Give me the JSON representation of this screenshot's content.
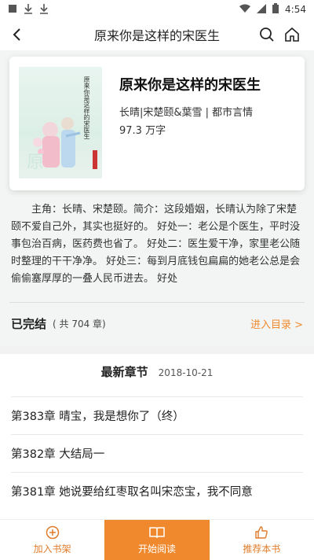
{
  "status_bar": {
    "time": "4:54",
    "icons": [
      "notification-square-icon",
      "download-icon",
      "download-icon",
      "wifi-icon",
      "signal-icon",
      "battery-icon"
    ]
  },
  "nav": {
    "title": "原来你是这样的宋医生",
    "icons": [
      "back-arrow-icon",
      "search-icon",
      "home-icon"
    ]
  },
  "book": {
    "title": "原来你是这样的宋医生",
    "meta": "长晴|宋楚颐&葉雪  |  都市言情",
    "words": "97.3 万字",
    "cover_text": "原来你是这样的宋医生"
  },
  "intro": "主角：长晴、宋楚颐。简介：这段婚姻，长晴认为除了宋楚颐不爱自己外，其实也挺好的。 好处一：老公是个医生，平时没事包治百病，医药费也省了。 好处二：医生爱干净，家里老公随时整理的干干净净。 好处三：每到月底钱包扁扁的她老公总是会偷偷塞厚厚的一叠人民币进去。 好处",
  "status": {
    "done_label": "已完结",
    "count_label": "( 共 704 章)",
    "enter_label": "进入目录 >"
  },
  "latest": {
    "heading": "最新章节",
    "date": "2018-10-21",
    "chapters": [
      "第383章 晴宝，我是想你了（终）",
      "第382章 大结局一",
      "第381章 她说要给红枣取名叫宋恋宝，我不同意"
    ]
  },
  "bottom_bar": {
    "add_shelf": "加入书架",
    "start_read": "开始阅读",
    "recommend": "推荐本书"
  },
  "colors": {
    "accent": "#f0892e",
    "accent_text": "#e07c2a"
  }
}
